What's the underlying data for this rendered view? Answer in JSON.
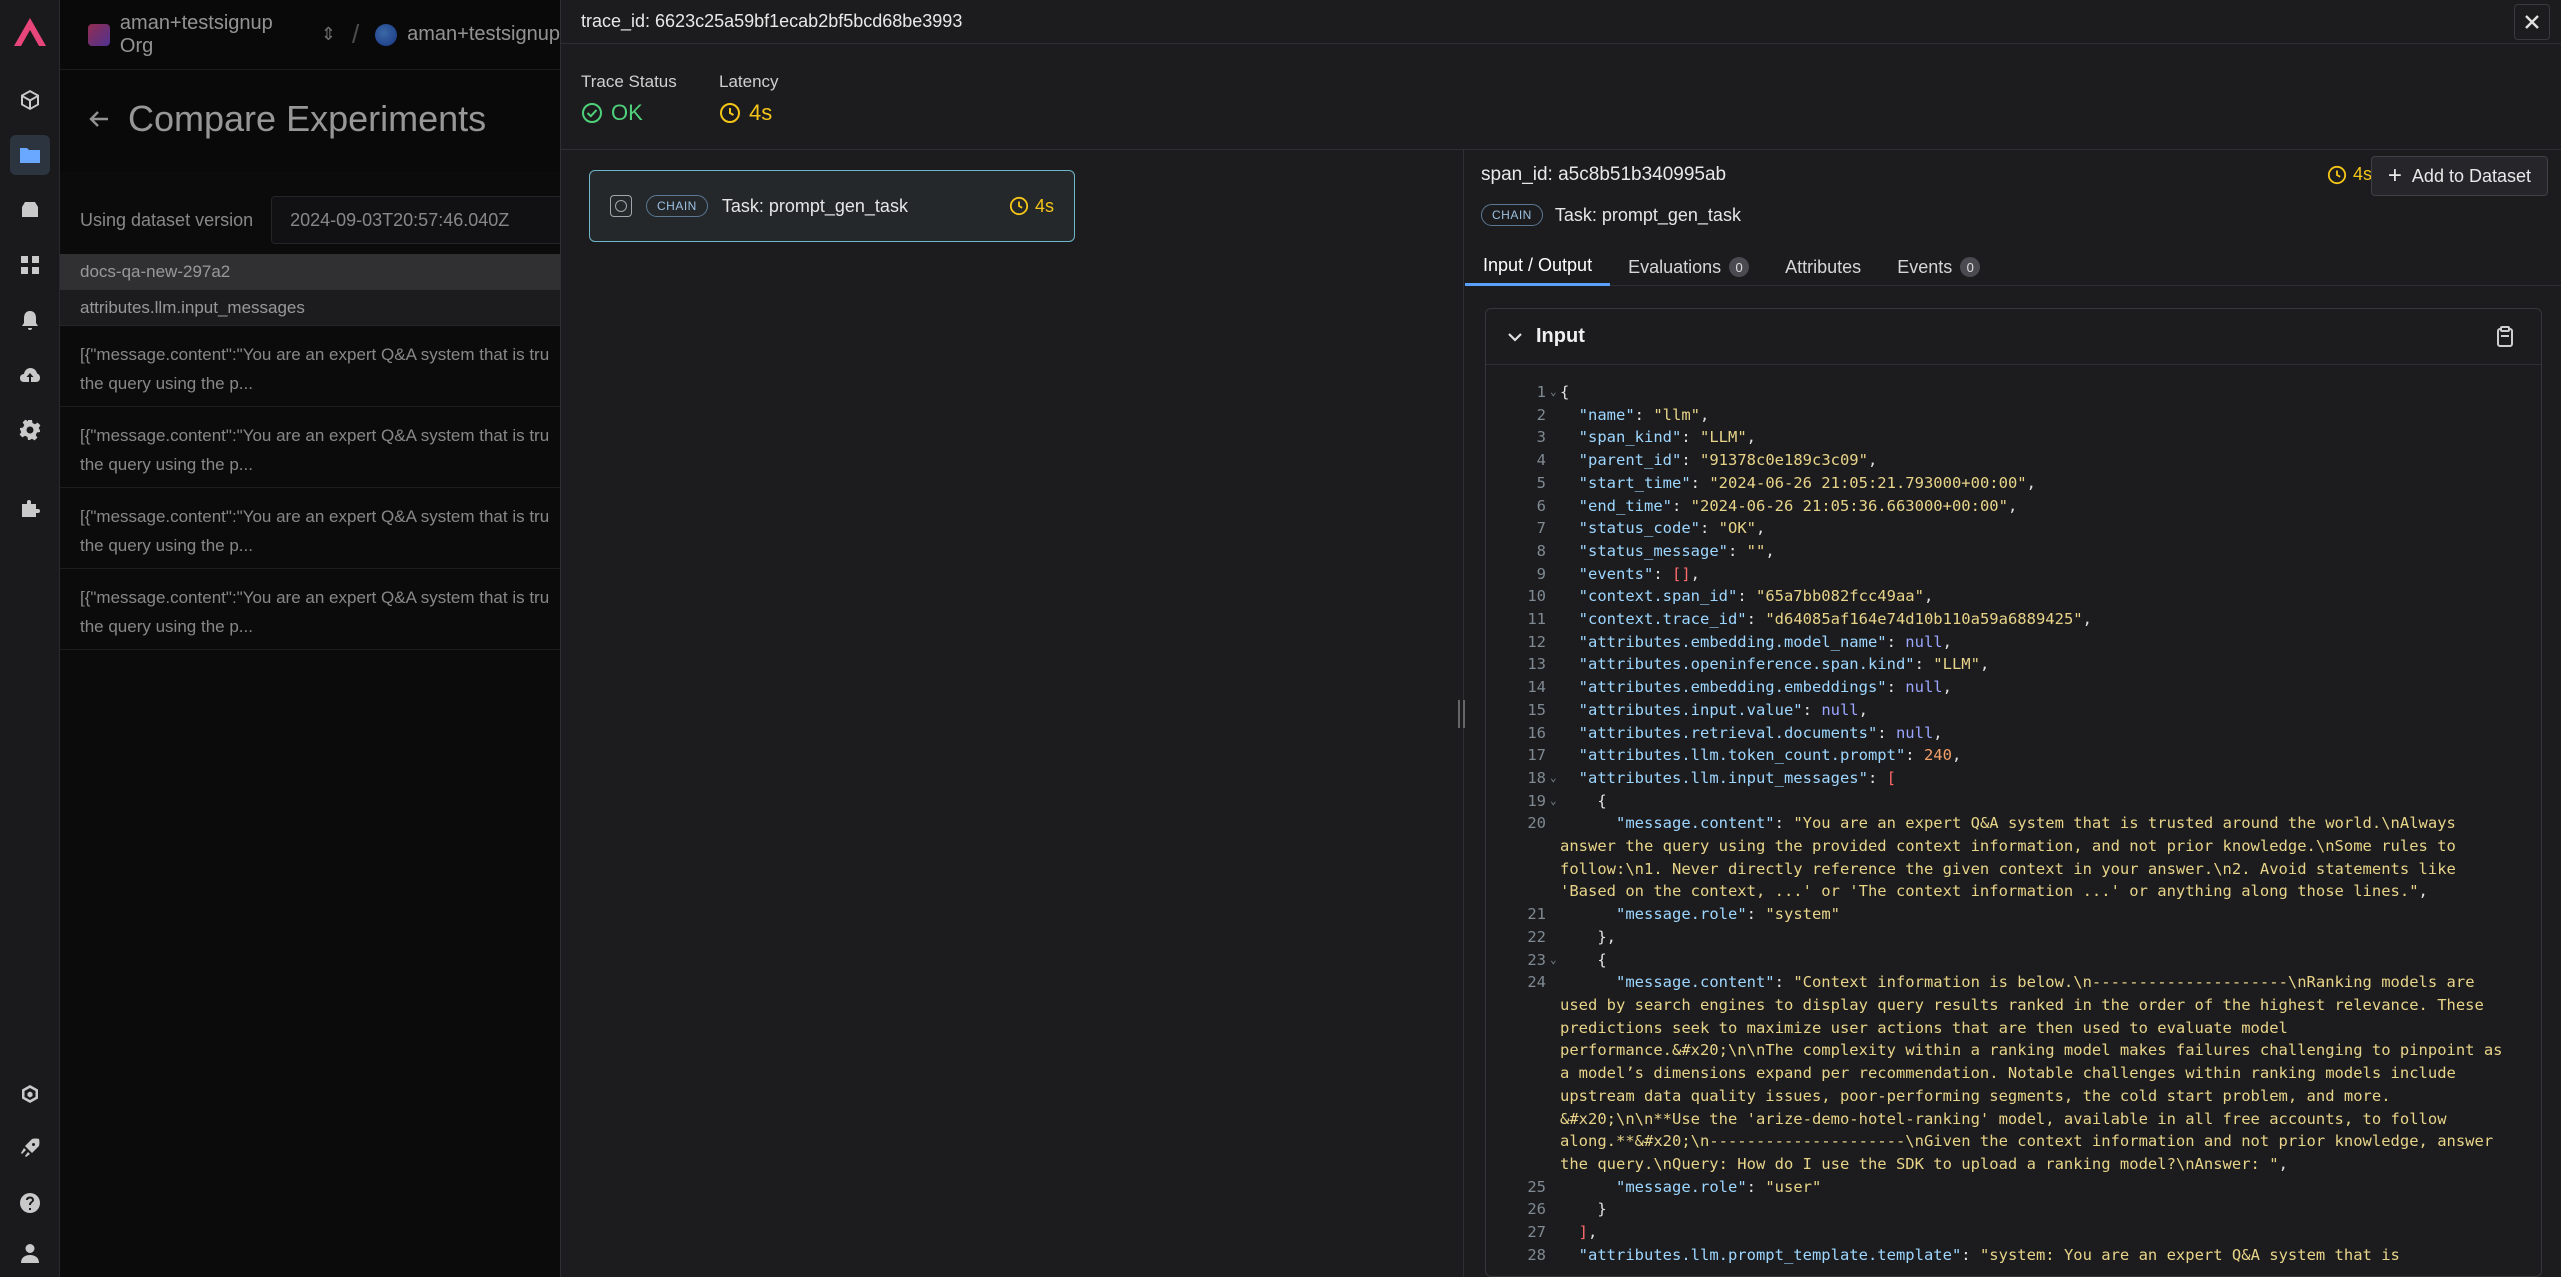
{
  "background": {
    "org_name": "aman+testsignup Org",
    "project_name": "aman+testsignup",
    "page_title": "Compare Experiments",
    "dataset_label": "Using dataset version",
    "dataset_version": "2024-09-03T20:57:46.040Z",
    "table_header": "docs-qa-new-297a2",
    "table_subheader": "attributes.llm.input_messages",
    "rows": [
      "[{\"message.content\":\"You are an expert Q&A system that is tru",
      "[{\"message.content\":\"You are an expert Q&A system that is tru",
      "[{\"message.content\":\"You are an expert Q&A system that is tru",
      "[{\"message.content\":\"You are an expert Q&A system that is tru"
    ],
    "rows_cont": "the query using the p..."
  },
  "drawer": {
    "trace_id": "trace_id: 6623c25a59bf1ecab2bf5bcd68be3993",
    "trace_status_label": "Trace Status",
    "trace_status_value": "OK",
    "latency_label": "Latency",
    "latency_value": "4s",
    "span_node": {
      "badge": "CHAIN",
      "label": "Task: prompt_gen_task",
      "latency": "4s"
    },
    "detail": {
      "span_id": "span_id: a5c8b51b340995ab",
      "latency": "4s",
      "add_button": "Add to Dataset",
      "kind_badge": "CHAIN",
      "kind_label": "Task: prompt_gen_task",
      "tabs": [
        {
          "label": "Input / Output",
          "count": null
        },
        {
          "label": "Evaluations",
          "count": "0"
        },
        {
          "label": "Attributes",
          "count": null
        },
        {
          "label": "Events",
          "count": "0"
        }
      ],
      "input_title": "Input"
    }
  },
  "colors": {
    "accent": "#5aa0ff",
    "ok": "#4fd17a",
    "latency": "#f5c518",
    "node_border": "#6fb6c9"
  },
  "icons": [
    "arize-logo",
    "cube-icon",
    "folder-icon",
    "database-icon",
    "grid-icon",
    "bell-icon",
    "cloud-upload-icon",
    "gear-icon",
    "puzzle-icon",
    "openai-icon",
    "rocket-icon",
    "help-icon",
    "user-icon"
  ]
}
